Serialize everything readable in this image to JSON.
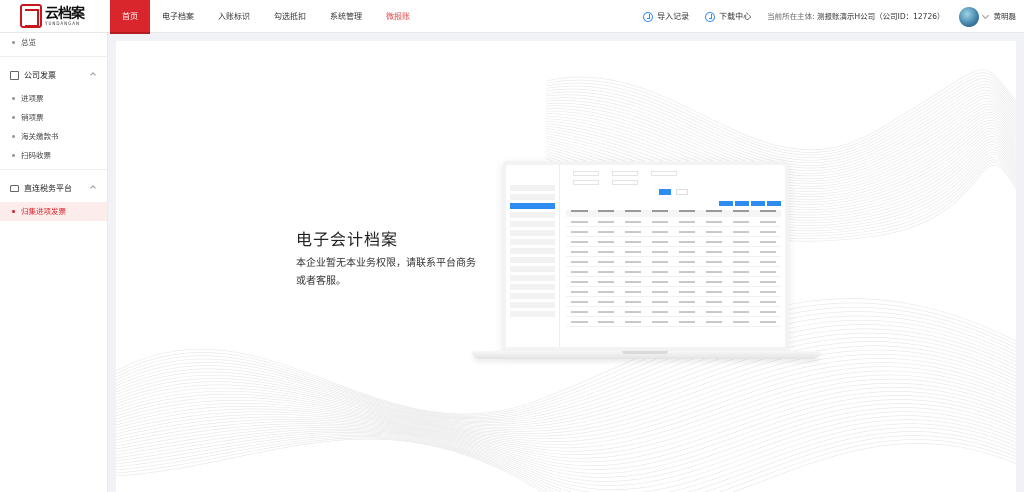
{
  "logo": {
    "cn": "云档案",
    "en": "YUNDANGAN"
  },
  "nav": [
    {
      "label": "首页",
      "active": true
    },
    {
      "label": "电子档案"
    },
    {
      "label": "入账标识"
    },
    {
      "label": "勾选抵扣"
    },
    {
      "label": "系统管理"
    },
    {
      "label": "微报账",
      "highlight": true
    }
  ],
  "tools": {
    "import": "导入记录",
    "download": "下载中心"
  },
  "company": {
    "prefix": "当前所在主体:",
    "name": "测报账演示H公司（公司ID：12726）"
  },
  "user": {
    "name": "黄明磊"
  },
  "sidebar": {
    "overview": "总览",
    "group1": {
      "label": "公司发票",
      "items": [
        "进项票",
        "销项票",
        "海关缴款书",
        "扫码收票"
      ]
    },
    "group2": {
      "label": "直连税务平台",
      "items": [
        "归集进项发票"
      ]
    }
  },
  "main": {
    "title": "电子会计档案",
    "description": "本企业暂无本业务权限，请联系平台商务或者客服。"
  },
  "colors": {
    "brand": "#d9262c",
    "accent": "#2d8cf0"
  }
}
